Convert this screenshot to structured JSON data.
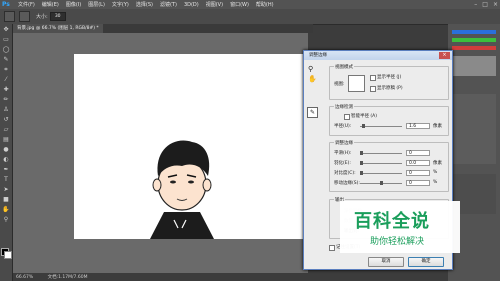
{
  "app": {
    "logo": "Ps"
  },
  "menu": [
    "文件(F)",
    "编辑(E)",
    "图像(I)",
    "图层(L)",
    "文字(Y)",
    "选择(S)",
    "滤镜(T)",
    "3D(D)",
    "视图(V)",
    "窗口(W)",
    "帮助(H)"
  ],
  "window_controls": [
    "–",
    "□",
    "×"
  ],
  "options_bar": {
    "size_label": "大小:",
    "size_value": "30"
  },
  "document": {
    "tab_title": "背景.jpg @ 66.7% (图层 1, RGB/8#) *"
  },
  "status": {
    "zoom": "66.67%",
    "doc_size": "文档:1.17M/7.60M"
  },
  "dialog": {
    "title": "调整边缘",
    "close": "×",
    "view_mode": {
      "group": "视图模式",
      "view_label": "视图:",
      "show_radius": "显示半径 (J)",
      "show_original": "显示原稿 (P)"
    },
    "edge_detection": {
      "group": "边缘检测",
      "smart_radius": "智能半径 (A)",
      "radius_label": "半径(U):",
      "radius_value": "1.6",
      "radius_unit": "像素",
      "radius_level": 0.05
    },
    "adjust_edge": {
      "group": "调整边缘",
      "rows": [
        {
          "label": "平滑(H):",
          "value": "0",
          "unit": "",
          "level": 0
        },
        {
          "label": "羽化(E):",
          "value": "0.0",
          "unit": "像素",
          "level": 0
        },
        {
          "label": "对比度(C):",
          "value": "0",
          "unit": "%",
          "level": 0
        },
        {
          "label": "移动边缘(S):",
          "value": "0",
          "unit": "%",
          "level": 0.5
        }
      ]
    },
    "output": {
      "group": "输出",
      "line1": "净化颜色",
      "line2": "数量",
      "line3": "输出到:"
    },
    "remember": "记住设置(T)",
    "cancel": "取消",
    "ok": "确定"
  },
  "watermark": {
    "title": "百科全说",
    "subtitle": "助你轻松解决"
  }
}
